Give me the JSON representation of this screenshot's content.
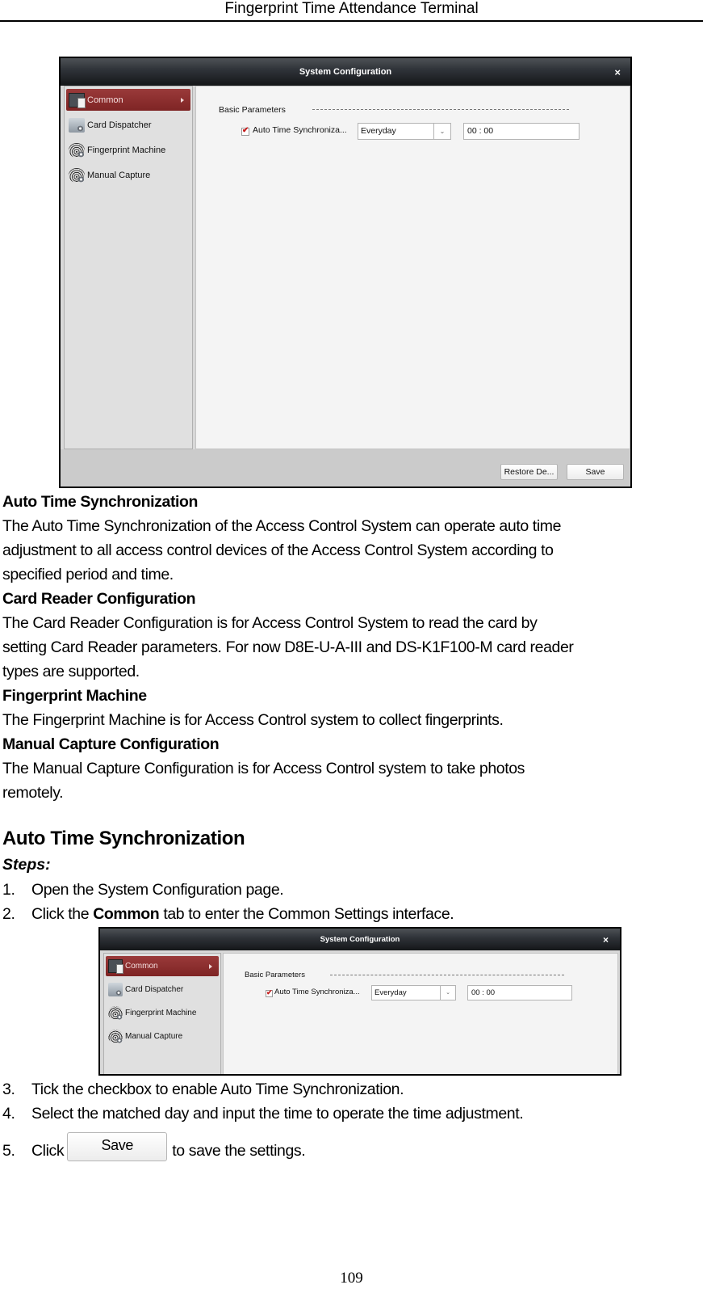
{
  "header": {
    "title": "Fingerprint Time Attendance Terminal"
  },
  "dialog": {
    "title": "System Configuration",
    "close_glyph": "×",
    "sidebar": [
      {
        "label": "Common",
        "icon": "monitor-icon",
        "active": true
      },
      {
        "label": "Card Dispatcher",
        "icon": "card-dispatcher-icon",
        "active": false
      },
      {
        "label": "Fingerprint Machine",
        "icon": "fingerprint-icon",
        "active": false
      },
      {
        "label": "Manual Capture",
        "icon": "capture-icon",
        "active": false
      }
    ],
    "section_label": "Basic Parameters",
    "auto_sync": {
      "label": "Auto Time Synchroniza...",
      "checked": true,
      "frequency": "Everyday",
      "dropdown_glyph": "⌄",
      "time": "00 : 00"
    },
    "buttons": {
      "restore": "Restore De...",
      "save": "Save"
    },
    "accent_color": "#8c2e2e"
  },
  "sections": [
    {
      "heading": "Auto Time Synchronization",
      "lines": [
        "The Auto Time Synchronization of the Access Control System can operate auto time",
        "adjustment to all access control devices of the Access Control System according to",
        "specified period and time."
      ]
    },
    {
      "heading": "Card Reader Configuration",
      "lines": [
        "The Card Reader Configuration is for Access Control System to read the card by",
        "setting Card Reader parameters. For now D8E-U-A-III and DS-K1F100-M card reader",
        "types are supported."
      ]
    },
    {
      "heading": "Fingerprint Machine",
      "lines": [
        "The Fingerprint Machine is for Access Control system to collect fingerprints."
      ]
    },
    {
      "heading": "Manual Capture Configuration",
      "lines": [
        "The Manual Capture Configuration is for Access Control system to take photos",
        "remotely."
      ]
    }
  ],
  "procedure": {
    "heading": "Auto Time Synchronization",
    "steps_label": "Steps:",
    "steps": [
      {
        "num": "1.",
        "text": "Open the System Configuration page."
      },
      {
        "num": "2.",
        "pre": "Click the ",
        "bold": "Common",
        "post": " tab to enter the Common Settings interface."
      },
      {
        "num": "3.",
        "text": "Tick the checkbox to enable Auto Time Synchronization."
      },
      {
        "num": "4.",
        "text": "Select the matched day and input the time to operate the time adjustment."
      },
      {
        "num": "5.",
        "pre": "Click",
        "button": "Save",
        "post": "to save the settings."
      }
    ]
  },
  "footer": {
    "page_number": "109"
  }
}
